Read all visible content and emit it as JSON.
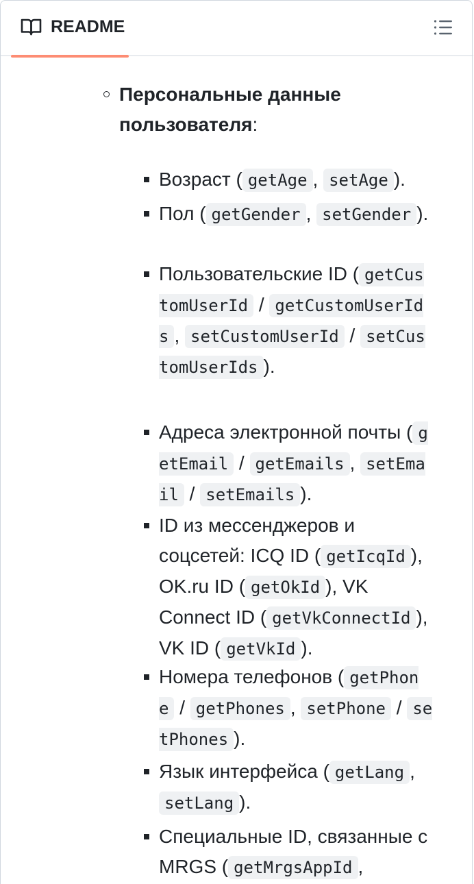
{
  "header": {
    "tab_label": "README",
    "accent_color": "#fd8c73",
    "icons": [
      "book-icon",
      "list-unordered-icon"
    ]
  },
  "section": {
    "title_bold": "Персональные данные пользователя",
    "title_suffix": ":"
  },
  "items": [
    {
      "parts": [
        {
          "t": "Возраст ("
        },
        {
          "c": "getAge"
        },
        {
          "t": ", "
        },
        {
          "c": "setAge"
        },
        {
          "t": ")."
        }
      ]
    },
    {
      "parts": [
        {
          "t": "Пол ("
        },
        {
          "c": "getGender"
        },
        {
          "t": ", "
        },
        {
          "c": "setGender"
        },
        {
          "t": ")."
        }
      ]
    },
    {
      "parts": [
        {
          "t": "Пользовательские ID ("
        },
        {
          "c": "getCustomUserId"
        },
        {
          "t": " / "
        },
        {
          "c": "getCustomUserIds"
        },
        {
          "t": ", "
        },
        {
          "c": "setCustomUserId"
        },
        {
          "t": " / "
        },
        {
          "c": "setCustomUserIds"
        },
        {
          "t": ")."
        }
      ]
    },
    {
      "parts": [
        {
          "t": "Адреса электронной почты ("
        },
        {
          "c": "getEmail"
        },
        {
          "t": " / "
        },
        {
          "c": "getEmails"
        },
        {
          "t": ", "
        },
        {
          "c": "setEmail"
        },
        {
          "t": " / "
        },
        {
          "c": "setEmails"
        },
        {
          "t": ")."
        }
      ]
    },
    {
      "parts": [
        {
          "t": "ID из мессенджеров и соцсетей: ICQ ID ("
        },
        {
          "c": "getIcqId"
        },
        {
          "t": "), OK.ru ID ("
        },
        {
          "c": "getOkId"
        },
        {
          "t": "), VK Connect ID ("
        },
        {
          "c": "getVkConnectId"
        },
        {
          "t": "), VK ID ("
        },
        {
          "c": "getVkId"
        },
        {
          "t": ")."
        }
      ]
    },
    {
      "parts": [
        {
          "t": "Номера телефонов ("
        },
        {
          "c": "getPhone"
        },
        {
          "t": " / "
        },
        {
          "c": "getPhones"
        },
        {
          "t": ", "
        },
        {
          "c": "setPhone"
        },
        {
          "t": " / "
        },
        {
          "c": "setPhones"
        },
        {
          "t": ")."
        }
      ]
    },
    {
      "parts": [
        {
          "t": "Язык интерфейса ("
        },
        {
          "c": "getLang"
        },
        {
          "t": ", "
        },
        {
          "c": "setLang"
        },
        {
          "t": ")."
        }
      ]
    },
    {
      "parts": [
        {
          "t": "Специальные ID, связанные с MRGS ("
        },
        {
          "c": "getMrgsAppId"
        },
        {
          "t": ","
        }
      ]
    }
  ]
}
